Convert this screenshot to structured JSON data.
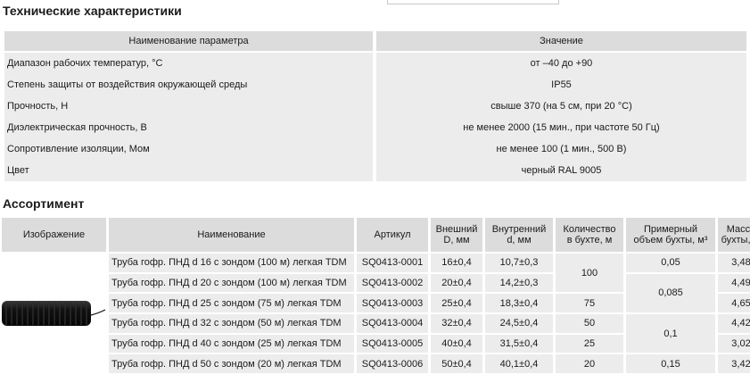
{
  "specs": {
    "title": "Технические характеристики",
    "header": {
      "param": "Наименование параметра",
      "value": "Значение"
    },
    "rows": [
      {
        "param": "Диапазон рабочих температур, °С",
        "value": "от –40 до +90"
      },
      {
        "param": "Степень защиты от воздействия окружающей среды",
        "value": "IP55"
      },
      {
        "param": "Прочность, Н",
        "value": "свыше 370 (на 5 см, при 20 °С)"
      },
      {
        "param": "Диэлектрическая прочность, В",
        "value": "не менее 2000 (15 мин., при частоте 50 Гц)"
      },
      {
        "param": "Сопротивление изоляции, Мом",
        "value": "не менее 100 (1 мин., 500 В)"
      },
      {
        "param": "Цвет",
        "value": "черный RAL 9005"
      }
    ]
  },
  "assortment": {
    "title": "Ассортимент",
    "headers": {
      "image": "Изображение",
      "name": "Наименование",
      "article": "Артикул",
      "outer_1": "Внешний",
      "outer_2": "D, мм",
      "inner_1": "Внутренний",
      "inner_2": "d, мм",
      "qty_1": "Количество",
      "qty_2": "в бухте, м",
      "vol_1": "Примерный",
      "vol_2": "объем бухты, м³",
      "mass_1": "Масса",
      "mass_2": "бухты, кг"
    },
    "rows": [
      {
        "name": "Труба гофр. ПНД d 16 с зондом (100 м) легкая TDM",
        "article": "SQ0413-0001",
        "outer": "16±0,4",
        "inner": "10,7±0,3",
        "mass": "3,48"
      },
      {
        "name": "Труба гофр. ПНД d 20 с зондом (100 м) легкая TDM",
        "article": "SQ0413-0002",
        "outer": "20±0,4",
        "inner": "14,2±0,3",
        "mass": "4,49"
      },
      {
        "name": "Труба гофр. ПНД d 25 с зондом (75 м) легкая TDM",
        "article": "SQ0413-0003",
        "outer": "25±0,4",
        "inner": "18,3±0,4",
        "mass": "4,65"
      },
      {
        "name": "Труба гофр. ПНД d 32 с зондом (50 м) легкая TDM",
        "article": "SQ0413-0004",
        "outer": "32±0,4",
        "inner": "24,5±0,4",
        "mass": "4,42"
      },
      {
        "name": "Труба гофр. ПНД d 40 с зондом (25 м) легкая TDM",
        "article": "SQ0413-0005",
        "outer": "40±0,4",
        "inner": "31,5±0,4",
        "mass": "3,02"
      },
      {
        "name": "Труба гофр. ПНД d 50 с зондом (20 м) легкая TDM",
        "article": "SQ0413-0006",
        "outer": "50±0,4",
        "inner": "40,1±0,4",
        "mass": "3,42"
      }
    ],
    "qty": [
      "100",
      "75",
      "50",
      "25",
      "20"
    ],
    "volume": [
      "0,05",
      "0,085",
      "0,1",
      "0,15"
    ]
  }
}
